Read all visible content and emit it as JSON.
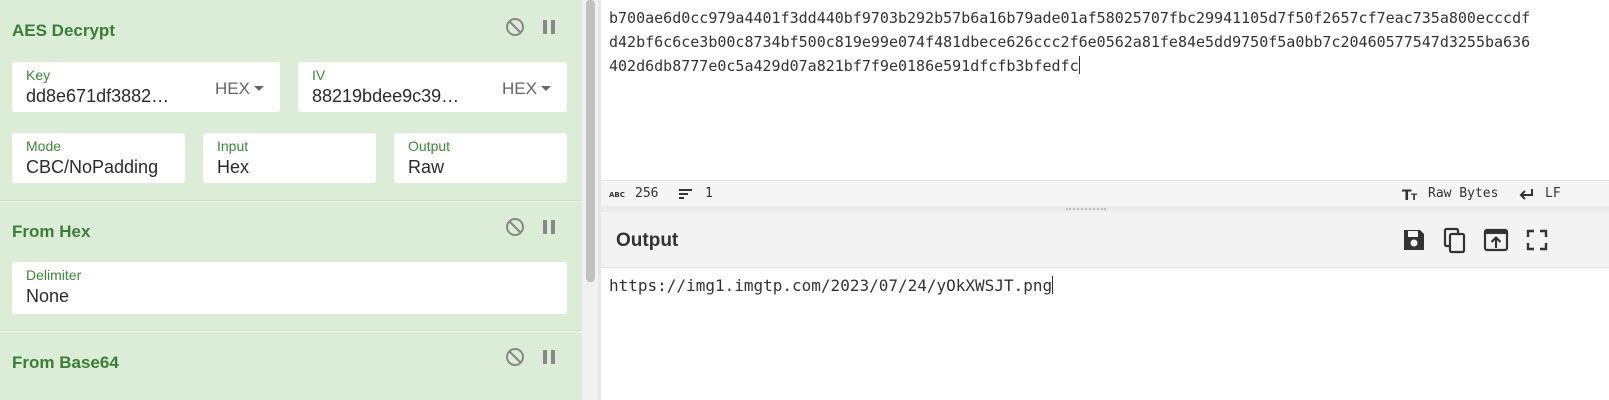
{
  "recipe": {
    "operations": [
      {
        "title": "AES Decrypt",
        "key": {
          "label": "Key",
          "value": "dd8e671df3882…",
          "format": "HEX"
        },
        "iv": {
          "label": "IV",
          "value": "88219bdee9c39…",
          "format": "HEX"
        },
        "mode": {
          "label": "Mode",
          "value": "CBC/NoPadding"
        },
        "input": {
          "label": "Input",
          "value": "Hex"
        },
        "output": {
          "label": "Output",
          "value": "Raw"
        }
      },
      {
        "title": "From Hex",
        "delimiter": {
          "label": "Delimiter",
          "value": "None"
        }
      },
      {
        "title": "From Base64"
      }
    ]
  },
  "input": {
    "lines": [
      "b700ae6d0cc979a4401f3dd440bf9703b292b57b6a16b79ade01af58025707fbc29941105d7f50f2657cf7eac735a800ecccdf",
      "d42bf6c6ce3b00c8734bf500c819e99e074f481dbece626ccc2f6e0562a81fe84e5dd9750f5a0bb7c20460577547d3255ba636",
      "402d6db8777e0c5a429d07a821bf7f9e0186e591dfcfb3bfedfc"
    ]
  },
  "status": {
    "char_icon": "abc-icon",
    "char_count": "256",
    "line_count": "1",
    "encoding": "Raw Bytes",
    "eol": "LF"
  },
  "output": {
    "title": "Output",
    "text": "https://img1.imgtp.com/2023/07/24/yOkXWSJT.png"
  },
  "colors": {
    "op_background": "#dcedd7",
    "op_title": "#3a7d35",
    "label_green": "#3a8a35"
  }
}
